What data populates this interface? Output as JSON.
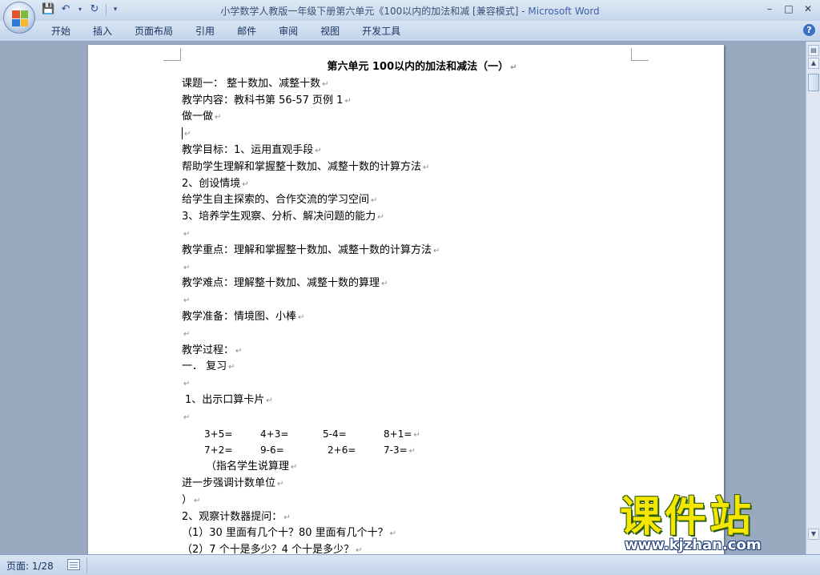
{
  "window": {
    "title_doc": "小学数学人教版一年级下册第六单元《100以内的加法和减 [兼容模式]",
    "title_sep": " - ",
    "title_app": "Microsoft Word"
  },
  "ribbon": {
    "tabs": [
      "开始",
      "插入",
      "页面布局",
      "引用",
      "邮件",
      "审阅",
      "视图",
      "开发工具"
    ],
    "help": "?"
  },
  "document": {
    "title": "第六单元    100以内的加法和减法（一）",
    "lines": [
      "课题一：  整十数加、减整十数",
      "教学内容：教科书第 56-57 页例 1",
      "做一做",
      "",
      "教学目标：1、运用直观手段",
      "帮助学生理解和掌握整十数加、减整十数的计算方法",
      "2、创设情境",
      "给学生自主探索的、合作交流的学习空间",
      "3、培养学生观察、分析、解决问题的能力",
      "",
      "教学重点：理解和掌握整十数加、减整十数的计算方法",
      "",
      "教学难点：理解整十数加、减整十数的算理",
      "",
      "教学准备：情境图、小棒",
      "",
      "教学过程：",
      "一．  复习",
      "",
      "1、出示口算卡片",
      ""
    ],
    "equations_row1": [
      "3+5=",
      "4+3=",
      "5-4=",
      "8+1="
    ],
    "equations_row2": [
      "7+2=",
      "9-6=",
      "2+6=",
      "7-3="
    ],
    "lines_after": [
      "（指名学生说算理",
      "进一步强调计数单位",
      "）",
      "2、观察计数器提问：",
      "（1）30 里面有几个十？80 里面有几个十？",
      "（2）7 个十是多少？4 个十是多少？"
    ],
    "paragraph_mark": "↵"
  },
  "status": {
    "page": "页面: 1/28"
  },
  "watermark": {
    "cn": "课件站",
    "url": "www.kjzhan.com"
  }
}
